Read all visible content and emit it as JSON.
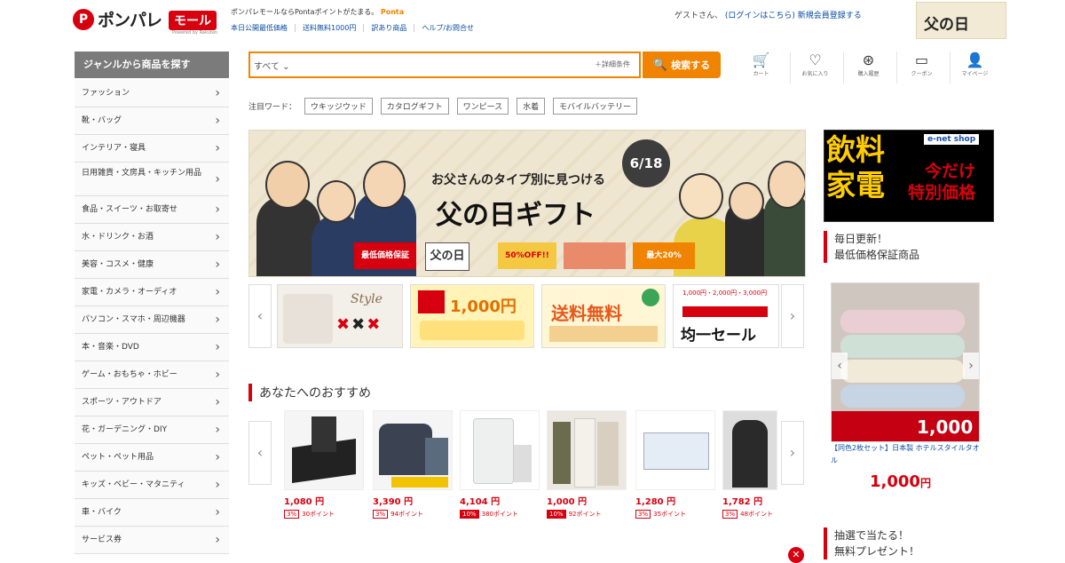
{
  "header": {
    "logo_text": "ポンパレ",
    "logo_mall": "モール",
    "logo_sub": "Powered by Rakuten",
    "tagline_prefix": "ポンパレモールならPontaポイントがたまる。",
    "ponta": "Ponta",
    "links": [
      "本日公開最低価格",
      "送料無料1000円",
      "訳あり商品",
      "ヘルプ/お問合せ"
    ],
    "guest_text": "ゲストさん、",
    "login_link": "(ログインはこちら)",
    "register_link": "新規会員登録する",
    "top_banner": "父の日"
  },
  "search": {
    "category": "すべて",
    "placeholder": "",
    "detail": "＋詳細条件",
    "button": "検索する"
  },
  "nav_icons": [
    {
      "name": "cart-icon",
      "glyph": "🛒",
      "label": "カート"
    },
    {
      "name": "heart-icon",
      "glyph": "♡",
      "label": "お気に入り"
    },
    {
      "name": "history-icon",
      "glyph": "⊛",
      "label": "購入履歴"
    },
    {
      "name": "coupon-icon",
      "glyph": "▭",
      "label": "クーポン"
    },
    {
      "name": "user-icon",
      "glyph": "👤",
      "label": "マイページ"
    }
  ],
  "sidebar": {
    "heading": "ジャンルから商品を探す",
    "items": [
      "ファッション",
      "靴・バッグ",
      "インテリア・寝具",
      "日用雑貨・文房具・キッチン用品",
      "食品・スイーツ・お取寄せ",
      "水・ドリンク・お酒",
      "美容・コスメ・健康",
      "家電・カメラ・オーディオ",
      "パソコン・スマホ・周辺機器",
      "本・音楽・DVD",
      "ゲーム・おもちゃ・ホビー",
      "スポーツ・アウトドア",
      "花・ガーデニング・DIY",
      "ペット・ペット用品",
      "キッズ・ベビー・マタニティ",
      "車・バイク",
      "サービス券"
    ]
  },
  "keywords": {
    "label": "注目ワード：",
    "tags": [
      "ウキッジウッド",
      "カタログギフト",
      "ワンピース",
      "水着",
      "モバイルバッテリー"
    ]
  },
  "hero": {
    "subtitle": "お父さんのタイプ別に見つける",
    "title": "父の日ギフト",
    "date": "6/18",
    "badge1": "最低価格保証",
    "badge2": "父の日",
    "badge3": "50%OFF!!",
    "badge4": "最大20%"
  },
  "mini_banners": {
    "b1": "Style",
    "b2": "1,000円",
    "b3": "送料無料",
    "b4": "均一セール",
    "b4_top": "1,000円・2,000円・3,000円"
  },
  "recommend": {
    "heading": "あなたへのおすすめ",
    "items": [
      {
        "price": "1,080 円",
        "rate": "3%",
        "points": "30ポイント",
        "highlight": false
      },
      {
        "price": "3,390 円",
        "rate": "3%",
        "points": "94ポイント",
        "highlight": false
      },
      {
        "price": "4,104 円",
        "rate": "10%",
        "points": "380ポイント",
        "highlight": true
      },
      {
        "price": "1,000 円",
        "rate": "10%",
        "points": "92ポイント",
        "highlight": true
      },
      {
        "price": "1,280 円",
        "rate": "3%",
        "points": "35ポイント",
        "highlight": false
      },
      {
        "price": "1,782 円",
        "rate": "3%",
        "points": "48ポイント",
        "highlight": false
      }
    ]
  },
  "right": {
    "ad_big": "飲料\n家電",
    "ad_small": "今だけ\n特別価格",
    "ad_shop": "e-net shop",
    "daily_head_1": "毎日更新！",
    "daily_head_2": "最低価格保証商品",
    "daily_name": "【同色2枚セット】日本製 ホテルスタイルタオル",
    "daily_price": "1,000",
    "daily_price_unit": "円",
    "lotto_1": "抽選で当たる！",
    "lotto_2": "無料プレゼント！"
  }
}
